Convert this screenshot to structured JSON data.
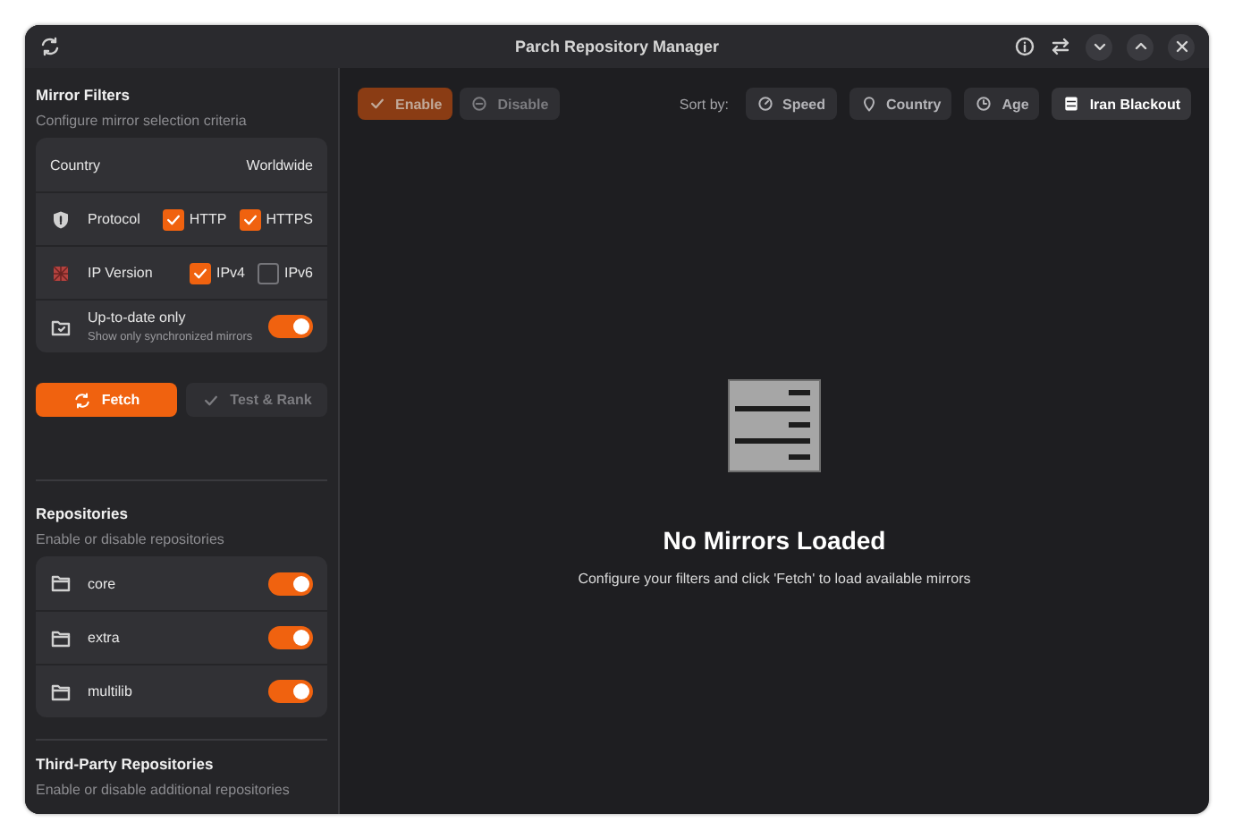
{
  "window": {
    "title": "Parch Repository Manager"
  },
  "sidebar": {
    "mirror_filters": {
      "title": "Mirror Filters",
      "subtitle": "Configure mirror selection criteria",
      "rows": [
        {
          "kind": "value",
          "label": "Country",
          "value": "Worldwide"
        },
        {
          "kind": "checks",
          "label": "Protocol",
          "options": [
            {
              "label": "HTTP",
              "checked": true
            },
            {
              "label": "HTTPS",
              "checked": true
            }
          ]
        },
        {
          "kind": "checks",
          "label": "IP Version",
          "options": [
            {
              "label": "IPv4",
              "checked": true
            },
            {
              "label": "IPv6",
              "checked": false
            }
          ]
        },
        {
          "kind": "toggle",
          "label": "Up-to-date only",
          "hint": "Show only synchronized mirrors",
          "on": true
        }
      ]
    },
    "actions": [
      {
        "label": "Fetch",
        "kind": "primary",
        "disabled": false
      },
      {
        "label": "Test & Rank",
        "kind": "secondary",
        "disabled": true
      }
    ],
    "repositories": {
      "title": "Repositories",
      "subtitle": "Enable or disable repositories",
      "items": [
        {
          "name": "core",
          "on": true
        },
        {
          "name": "extra",
          "on": true
        },
        {
          "name": "multilib",
          "on": true
        }
      ]
    },
    "third_party": {
      "title": "Third-Party Repositories",
      "subtitle": "Enable or disable additional repositories"
    }
  },
  "toolbar": {
    "actions": [
      {
        "label": "Enable",
        "kind": "primary",
        "disabled": true
      },
      {
        "label": "Disable",
        "kind": "secondary",
        "disabled": true
      }
    ],
    "sort_label": "Sort by:",
    "sort_options": [
      {
        "label": "Speed",
        "selected": false
      },
      {
        "label": "Country",
        "selected": false
      },
      {
        "label": "Age",
        "selected": false
      },
      {
        "label": "Iran Blackout",
        "selected": true
      }
    ]
  },
  "empty_state": {
    "title": "No Mirrors Loaded",
    "message": "Configure your filters and click 'Fetch' to load available mirrors"
  }
}
